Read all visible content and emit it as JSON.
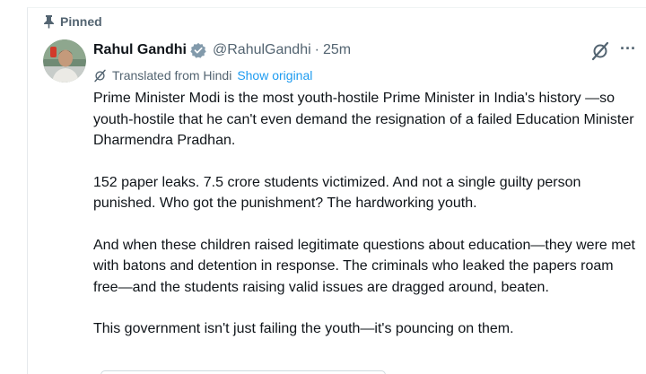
{
  "pinned": {
    "label": "Pinned"
  },
  "author": {
    "display_name": "Rahul Gandhi",
    "handle": "@RahulGandhi",
    "separator": "·",
    "time": "25m",
    "verified_color": "#829aab"
  },
  "translation": {
    "label": "Translated from Hindi",
    "show_original": "Show original"
  },
  "tweet": {
    "paragraphs": [
      "Prime Minister Modi is the most youth-hostile Prime Minister in India's history —so youth-hostile that he can't even demand the resignation of a failed Education Minister Dharmendra Pradhan.",
      "152 paper leaks. 7.5 crore students victimized. And not a single guilty person punished. Who got the punishment? The hardworking youth.",
      "And when these children raised legitimate questions about education—they were met with batons and detention in response. The criminals who leaked the papers roam free—and the students raising valid issues are dragged around, beaten.",
      "This government isn't just failing the youth—it's pouncing on them."
    ]
  },
  "actions": {
    "more_label": "···"
  },
  "icons": {
    "pin": "pin-icon",
    "verified": "verified-badge-icon",
    "grok": "grok-icon",
    "more": "more-icon",
    "translate": "translate-icon"
  },
  "colors": {
    "link": "#1d9bf0",
    "secondary_text": "#536471",
    "primary_text": "#0f1419"
  }
}
